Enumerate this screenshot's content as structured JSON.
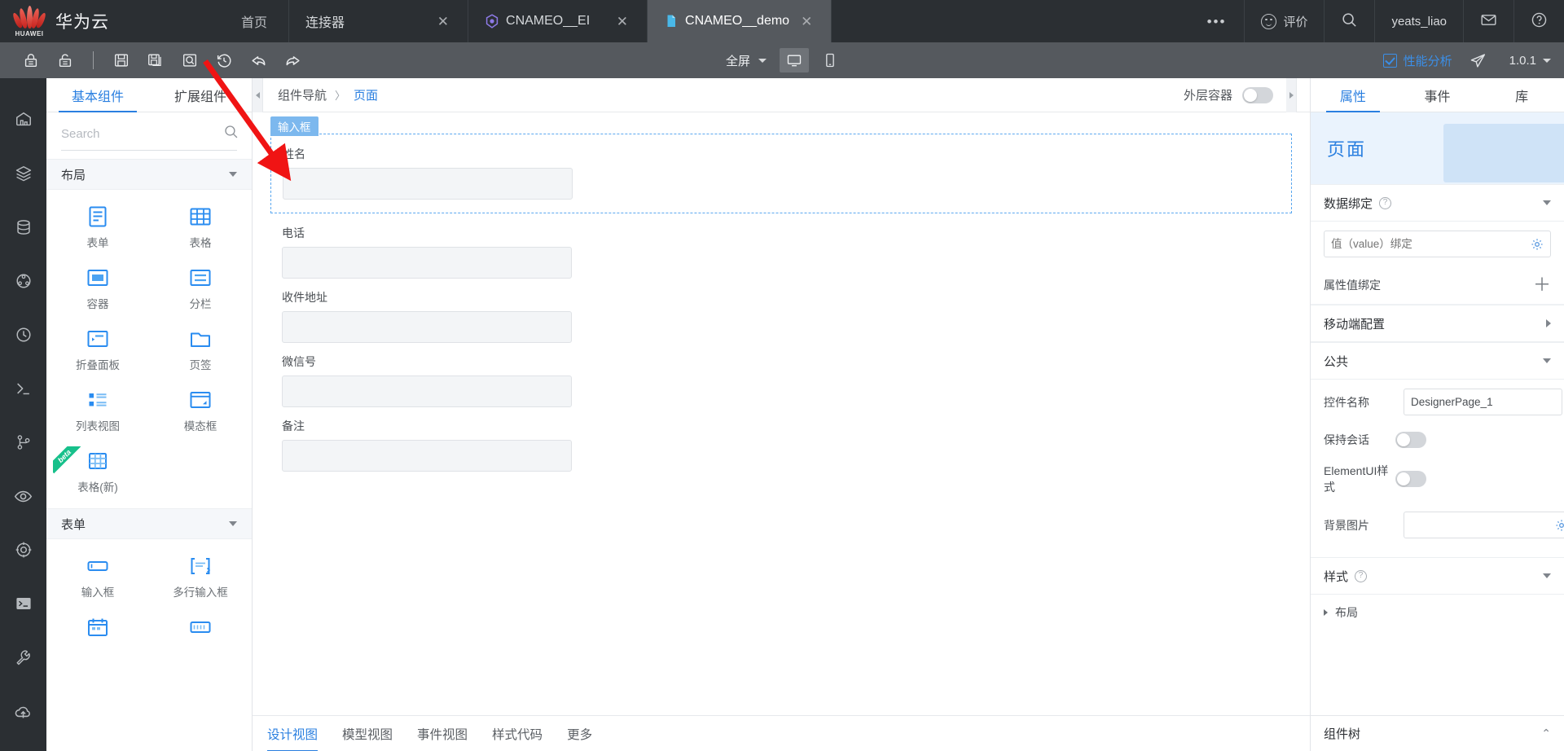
{
  "topbar": {
    "brand": "华为云",
    "brand_sub": "HUAWEI",
    "home_tab": "首页",
    "tabs": [
      {
        "label": "连接器",
        "icon": "none",
        "active": false,
        "close": "✕"
      },
      {
        "label": "CNAMEO__EI",
        "icon": "hex-icon",
        "active": false,
        "close": "✕"
      },
      {
        "label": "CNAMEO__demo",
        "icon": "file-icon",
        "active": true,
        "close": "✕"
      }
    ],
    "overflow_dots": "•••",
    "right_items": [
      {
        "label": "评价",
        "icon": "smiley-icon"
      },
      {
        "label": "",
        "icon": "search-icon"
      },
      {
        "label": "yeats_liao",
        "icon": "none"
      },
      {
        "label": "",
        "icon": "mail-icon"
      },
      {
        "label": "",
        "icon": "help-icon"
      }
    ]
  },
  "toolbar": {
    "left_icons": [
      "lock-icon",
      "unlock-icon",
      "divider",
      "save-icon",
      "save-as-icon",
      "preview-icon",
      "history-icon",
      "undo-icon",
      "redo-icon"
    ],
    "screen_mode": "全屏",
    "device_desktop": "desktop-icon",
    "device_mobile": "mobile-icon",
    "perf_label": "性能分析",
    "send_icon": "send-icon",
    "version": "1.0.1"
  },
  "rail": {
    "items": [
      "dashboard-icon",
      "layers-icon",
      "database-icon",
      "flow-icon",
      "history-icon",
      "script-icon",
      "branch-icon",
      "eye-icon",
      "target-icon",
      "terminal-icon",
      "wrench-icon",
      "cloud-upload-icon"
    ]
  },
  "complib": {
    "tabs": [
      {
        "label": "基本组件",
        "active": true
      },
      {
        "label": "扩展组件",
        "active": false
      }
    ],
    "search_placeholder": "Search",
    "search_value": "",
    "search_icon": "search-icon",
    "groups": [
      {
        "title": "布局",
        "expanded": true,
        "items": [
          {
            "name": "表单",
            "icon": "form-icon",
            "beta": false
          },
          {
            "name": "表格",
            "icon": "table-icon",
            "beta": false
          },
          {
            "name": "容器",
            "icon": "container-icon",
            "beta": false
          },
          {
            "name": "分栏",
            "icon": "column-icon",
            "beta": false
          },
          {
            "name": "折叠面板",
            "icon": "collapse-icon",
            "beta": false
          },
          {
            "name": "页签",
            "icon": "tab-icon",
            "beta": false
          },
          {
            "name": "列表视图",
            "icon": "listview-icon",
            "beta": false
          },
          {
            "name": "模态框",
            "icon": "modal-icon",
            "beta": false
          },
          {
            "name": "表格(新)",
            "icon": "table-new-icon",
            "beta": true,
            "beta_label": "beta"
          }
        ]
      },
      {
        "title": "表单",
        "expanded": true,
        "items": [
          {
            "name": "输入框",
            "icon": "input-icon",
            "beta": false
          },
          {
            "name": "多行输入框",
            "icon": "textarea-icon",
            "beta": false
          },
          {
            "name": "",
            "icon": "date-icon",
            "beta": false
          },
          {
            "name": "",
            "icon": "number-icon",
            "beta": false
          }
        ]
      }
    ]
  },
  "center": {
    "breadcrumb": [
      {
        "label": "组件导航",
        "link": false
      },
      {
        "label": "页面",
        "link": true
      }
    ],
    "breadcrumb_sep": "〉",
    "outer_container_label": "外层容器",
    "outer_container_on": false,
    "selection_tag": "输入框",
    "fields": [
      {
        "label": "姓名",
        "selected": true
      },
      {
        "label": "电话",
        "selected": false
      },
      {
        "label": "收件地址",
        "selected": false
      },
      {
        "label": "微信号",
        "selected": false
      },
      {
        "label": "备注",
        "selected": false
      }
    ],
    "bottom_tabs": [
      {
        "label": "设计视图",
        "active": true
      },
      {
        "label": "模型视图",
        "active": false
      },
      {
        "label": "事件视图",
        "active": false
      },
      {
        "label": "样式代码",
        "active": false
      },
      {
        "label": "更多",
        "active": false
      }
    ]
  },
  "props": {
    "tabs": [
      {
        "label": "属性",
        "active": true
      },
      {
        "label": "事件",
        "active": false
      },
      {
        "label": "库",
        "active": false
      }
    ],
    "hero_title": "页面",
    "sections": [
      {
        "title": "数据绑定",
        "help": "?",
        "expanded": true
      },
      {
        "title": "移动端配置",
        "help": "",
        "expanded": false
      },
      {
        "title": "公共",
        "help": "",
        "expanded": true
      },
      {
        "title": "样式",
        "help": "?",
        "expanded": true
      }
    ],
    "value_binding_placeholder": "值（value）绑定",
    "value_binding_value": "",
    "attr_binding_label": "属性值绑定",
    "attr_binding_plus": "＋",
    "ctrl_name_label": "控件名称",
    "ctrl_name_value": "DesignerPage_1",
    "keep_session_label": "保持会话",
    "keep_session_on": false,
    "elementui_label": "ElementUI样式",
    "elementui_on": false,
    "bg_image_label": "背景图片",
    "bg_image_value": "",
    "style_layout_label": "布局",
    "tree_title": "组件树",
    "tree_collapse_icon": "chevron-up-icon"
  }
}
